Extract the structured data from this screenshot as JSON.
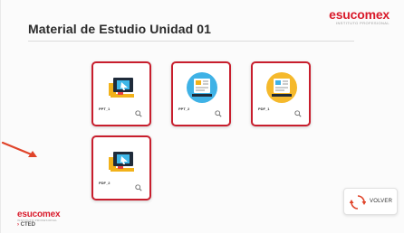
{
  "header": {
    "title": "Material de Estudio Unidad 01",
    "brand_name": "esucomex",
    "brand_tagline": "INSTITUTO PROFESIONAL"
  },
  "materials": [
    {
      "label": "PPT_1",
      "icon": "presentation-thumbnail-icon"
    },
    {
      "label": "PPT_2",
      "icon": "document-thumbnail-icon"
    },
    {
      "label": "PDF_1",
      "icon": "document-thumbnail-icon"
    },
    {
      "label": "PDF_2",
      "icon": "presentation-thumbnail-icon"
    }
  ],
  "back_button": {
    "label": "VOLVER"
  },
  "footer": {
    "brand_name": "esucomex",
    "brand_tagline": "INSTITUTO PROFESIONAL",
    "cted_label": "CTED"
  },
  "colors": {
    "accent": "#c81e2d",
    "brand": "#d91b2b"
  }
}
